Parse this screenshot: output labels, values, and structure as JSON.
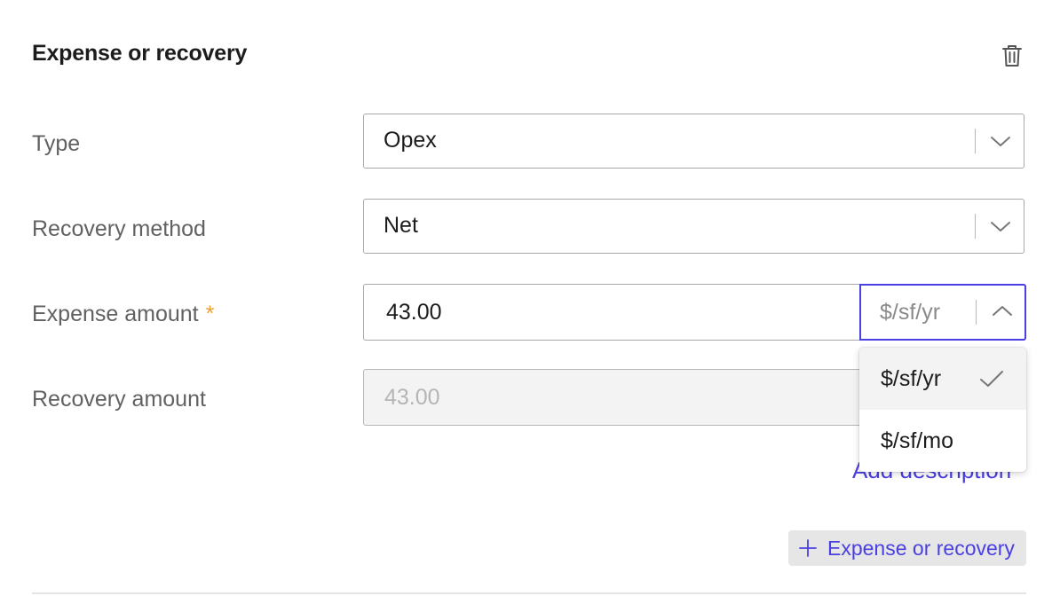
{
  "section": {
    "title": "Expense or recovery",
    "delete_icon": "trash-icon"
  },
  "fields": {
    "type": {
      "label": "Type",
      "value": "Opex"
    },
    "recovery_method": {
      "label": "Recovery method",
      "value": "Net"
    },
    "expense_amount": {
      "label": "Expense amount",
      "required_mark": "*",
      "value": "43.00",
      "unit": "$/sf/yr"
    },
    "recovery_amount": {
      "label": "Recovery amount",
      "value": "43.00"
    }
  },
  "unit_dropdown": {
    "options": [
      {
        "label": "$/sf/yr",
        "selected": true
      },
      {
        "label": "$/sf/mo",
        "selected": false
      }
    ]
  },
  "add_description_label": "Add description",
  "add_button": {
    "label": "Expense or recovery",
    "icon": "plus-icon"
  },
  "colors": {
    "accent": "#4a3fe0",
    "required": "#f0a030",
    "label": "#616161"
  }
}
